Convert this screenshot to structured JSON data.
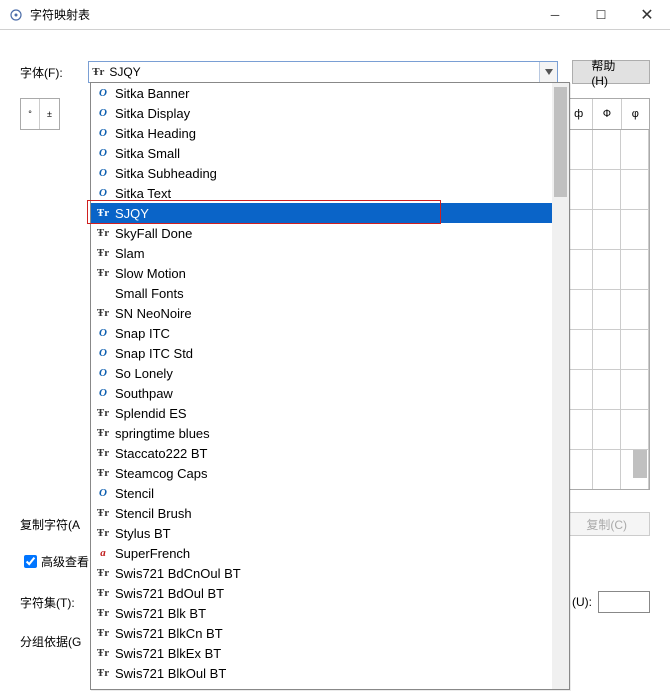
{
  "window": {
    "title": "字符映射表"
  },
  "labels": {
    "font": "字体(F):",
    "help": "帮助(H)",
    "copychars": "复制字符(A",
    "copy": "复制(C)",
    "advanced": "高级查看",
    "charset": "字符集(T):",
    "unicode_lbl": "(U):",
    "group": "分组依据(G"
  },
  "combo": {
    "value": "SJQY",
    "icon": "tt"
  },
  "topleft_cells": [
    "°",
    "±"
  ],
  "topright_cells": [
    "ф",
    "Ф",
    "φ"
  ],
  "dropdown": {
    "selected_index": 6,
    "items": [
      {
        "icon": "ot",
        "label": "Sitka Banner"
      },
      {
        "icon": "ot",
        "label": "Sitka Display"
      },
      {
        "icon": "ot",
        "label": "Sitka Heading"
      },
      {
        "icon": "ot",
        "label": "Sitka Small"
      },
      {
        "icon": "ot",
        "label": "Sitka Subheading"
      },
      {
        "icon": "ot",
        "label": "Sitka Text"
      },
      {
        "icon": "tt",
        "label": "SJQY"
      },
      {
        "icon": "tt",
        "label": "SkyFall Done"
      },
      {
        "icon": "tt",
        "label": "Slam"
      },
      {
        "icon": "tt",
        "label": "Slow Motion"
      },
      {
        "icon": "",
        "label": "Small Fonts"
      },
      {
        "icon": "tt",
        "label": "SN NeoNoire"
      },
      {
        "icon": "ot",
        "label": "Snap ITC"
      },
      {
        "icon": "ot",
        "label": "Snap ITC Std"
      },
      {
        "icon": "ot",
        "label": "So Lonely"
      },
      {
        "icon": "ot",
        "label": "Southpaw"
      },
      {
        "icon": "tt",
        "label": "Splendid ES"
      },
      {
        "icon": "tt",
        "label": "springtime blues"
      },
      {
        "icon": "tt",
        "label": "Staccato222 BT"
      },
      {
        "icon": "tt",
        "label": "Steamcog Caps"
      },
      {
        "icon": "ot",
        "label": "Stencil"
      },
      {
        "icon": "tt",
        "label": "Stencil Brush"
      },
      {
        "icon": "tt",
        "label": "Stylus BT"
      },
      {
        "icon": "a",
        "label": "SuperFrench"
      },
      {
        "icon": "tt",
        "label": "Swis721 BdCnOul BT"
      },
      {
        "icon": "tt",
        "label": "Swis721 BdOul BT"
      },
      {
        "icon": "tt",
        "label": "Swis721 Blk BT"
      },
      {
        "icon": "tt",
        "label": "Swis721 BlkCn BT"
      },
      {
        "icon": "tt",
        "label": "Swis721 BlkEx BT"
      },
      {
        "icon": "tt",
        "label": "Swis721 BlkOul BT"
      }
    ]
  }
}
